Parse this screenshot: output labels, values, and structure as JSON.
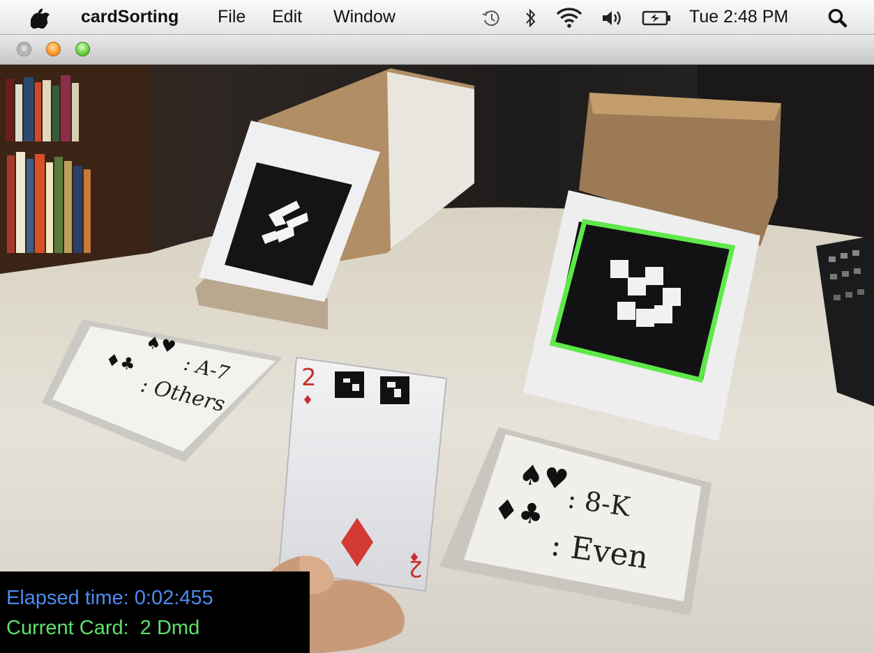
{
  "menubar": {
    "apple_icon": "apple-logo-icon",
    "app_name": "cardSorting",
    "menus": [
      "File",
      "Edit",
      "Window"
    ],
    "status_icons": [
      "time-machine-icon",
      "bluetooth-icon",
      "wifi-icon",
      "volume-icon",
      "battery-icon"
    ],
    "clock": "Tue 2:48 PM",
    "search_icon": "spotlight-search-icon"
  },
  "window": {
    "buttons": [
      "close-button",
      "minimize-button",
      "zoom-button"
    ]
  },
  "scene": {
    "left_card": {
      "line1": ": A-7",
      "line2": ": Others"
    },
    "right_card": {
      "line1": ": 8-K",
      "line2": ": Even"
    },
    "playing_card": {
      "rank": "2",
      "suit": "♦"
    }
  },
  "overlay": {
    "elapsed": "Elapsed time: 0:02:455",
    "current_card": "Current Card:  2 Dmd"
  },
  "colors": {
    "detection_outline": "#5fe84a",
    "elapsed_text": "#4b8cf0",
    "current_card_text": "#5fe06c"
  }
}
